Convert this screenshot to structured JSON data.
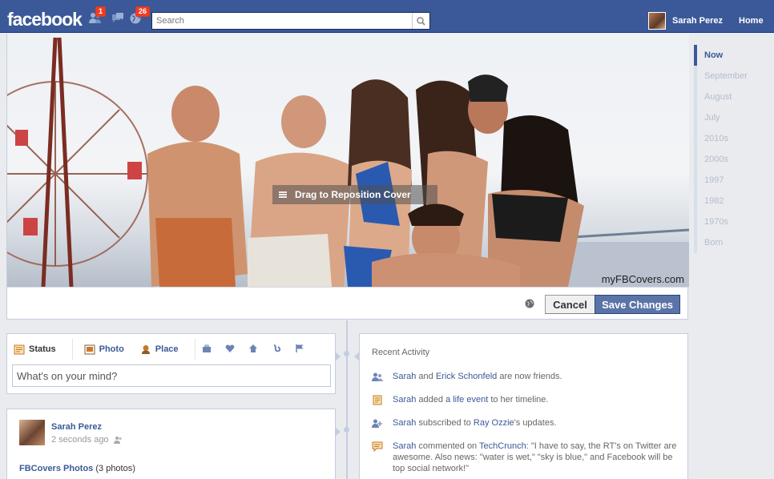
{
  "topbar": {
    "logo": "facebook",
    "friend_requests_count": "1",
    "notifications_count": "26",
    "search_placeholder": "Search",
    "profile_name": "Sarah Perez",
    "home_label": "Home"
  },
  "cover": {
    "drag_label": "Drag to Reposition Cover",
    "watermark": "myFBCovers.com",
    "cancel_label": "Cancel",
    "save_label": "Save Changes"
  },
  "scrubber": [
    "Now",
    "September",
    "August",
    "July",
    "2010s",
    "2000s",
    "1997",
    "1982",
    "1970s",
    "Born"
  ],
  "composer": {
    "tabs": [
      "Status",
      "Photo",
      "Place"
    ],
    "placeholder": "What's on your mind?"
  },
  "post": {
    "name": "Sarah Perez",
    "time": "2 seconds ago",
    "album": "FBCovers Photos",
    "album_count": "(3 photos)"
  },
  "recent": {
    "title": "Recent Activity",
    "items": [
      {
        "a": "Sarah",
        "b": " and ",
        "c": "Erick Schonfeld",
        "d": " are now friends.",
        "e": "",
        "f": ""
      },
      {
        "a": "Sarah",
        "b": " added ",
        "c": "a life event",
        "d": " to her timeline.",
        "e": "",
        "f": ""
      },
      {
        "a": "Sarah",
        "b": " subscribed to ",
        "c": "Ray Ozzie",
        "d": "'s updates.",
        "e": "",
        "f": ""
      },
      {
        "a": "Sarah",
        "b": " commented on ",
        "c": "TechCrunch",
        "d": ": \"I have to say, the RT's on Twitter are awesome. Also news: \"water is wet,\" \"sky is blue,\" and Facebook will be top social network!\"",
        "e": "",
        "f": ""
      }
    ]
  },
  "colors": {
    "brand_blue": "#3b5998",
    "save_button": "#5b74a8",
    "badge_red": "#f03d25"
  }
}
